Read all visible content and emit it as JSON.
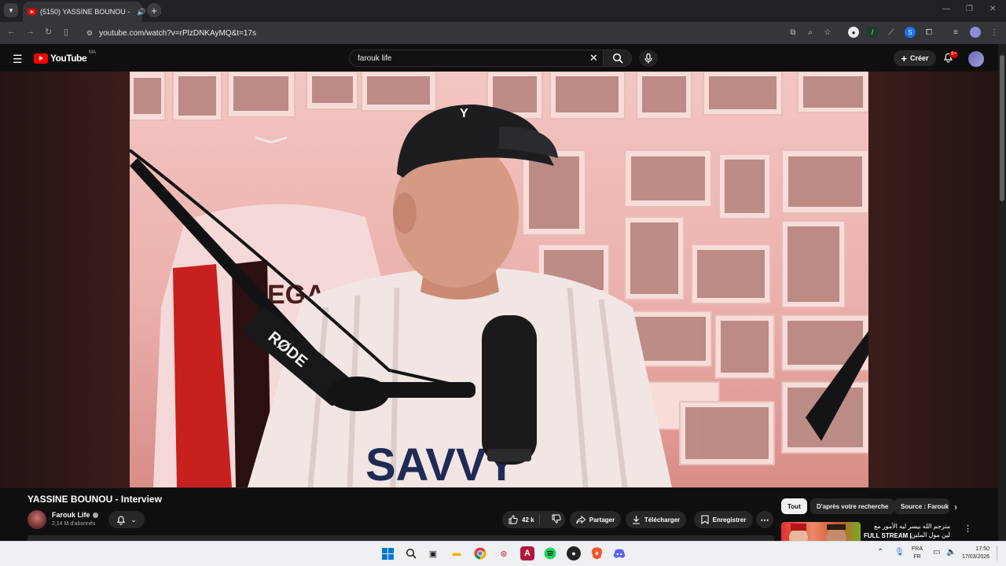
{
  "browser": {
    "tab_title": "(5150) YASSINE BOUNOU -",
    "new_tab": "+",
    "url": "youtube.com/watch?v=rPlzDNKAyMQ&t=17s",
    "window_controls": [
      "—",
      "❐",
      "✕"
    ]
  },
  "youtube": {
    "logo_text": "YouTube",
    "country_code": "MA",
    "search_value": "farouk life",
    "create_label": "Créer",
    "notification_badge": "9+"
  },
  "video": {
    "title": "YASSINE BOUNOU - Interview",
    "channel_name": "Farouk Life",
    "subscribers": "2,14 M d'abonnés",
    "likes": "42 k",
    "share_label": "Partager",
    "download_label": "Télécharger",
    "save_label": "Enregistrer",
    "mic_brand": "RØDE",
    "shirt_text": "SAVVY",
    "jersey_text": "EGA"
  },
  "sidebar": {
    "chips": [
      "Tout",
      "D'après votre recherche",
      "Source : Farouk"
    ],
    "reco_title_ar": "مترجم الله بيسر ليه الأمور مع لين مول الملين",
    "reco_subtitle": "FULL STREAM |"
  },
  "taskbar": {
    "lang_top": "FRA",
    "lang_bottom": "FR",
    "time": "17:50",
    "date": "17/03/2026"
  },
  "icons": [
    "tab-menu-icon",
    "youtube-favicon",
    "audio-icon",
    "close-icon",
    "back-icon",
    "forward-icon",
    "reload-icon",
    "sidebar-icon",
    "site-info-icon",
    "install-icon",
    "zoom-icon",
    "star-icon",
    "extension-icons",
    "menu-icon",
    "search-icon",
    "mic-icon",
    "bell-icon",
    "like-icon",
    "dislike-icon",
    "share-icon",
    "download-icon",
    "save-icon",
    "more-icon",
    "windows-icon",
    "explorer-icon",
    "chrome-icon",
    "spotify-icon",
    "brave-icon",
    "discord-icon"
  ],
  "colors": {
    "yt_red": "#ff0000",
    "bg": "#0f0f0f",
    "chip_active": "#f1f1f1"
  }
}
